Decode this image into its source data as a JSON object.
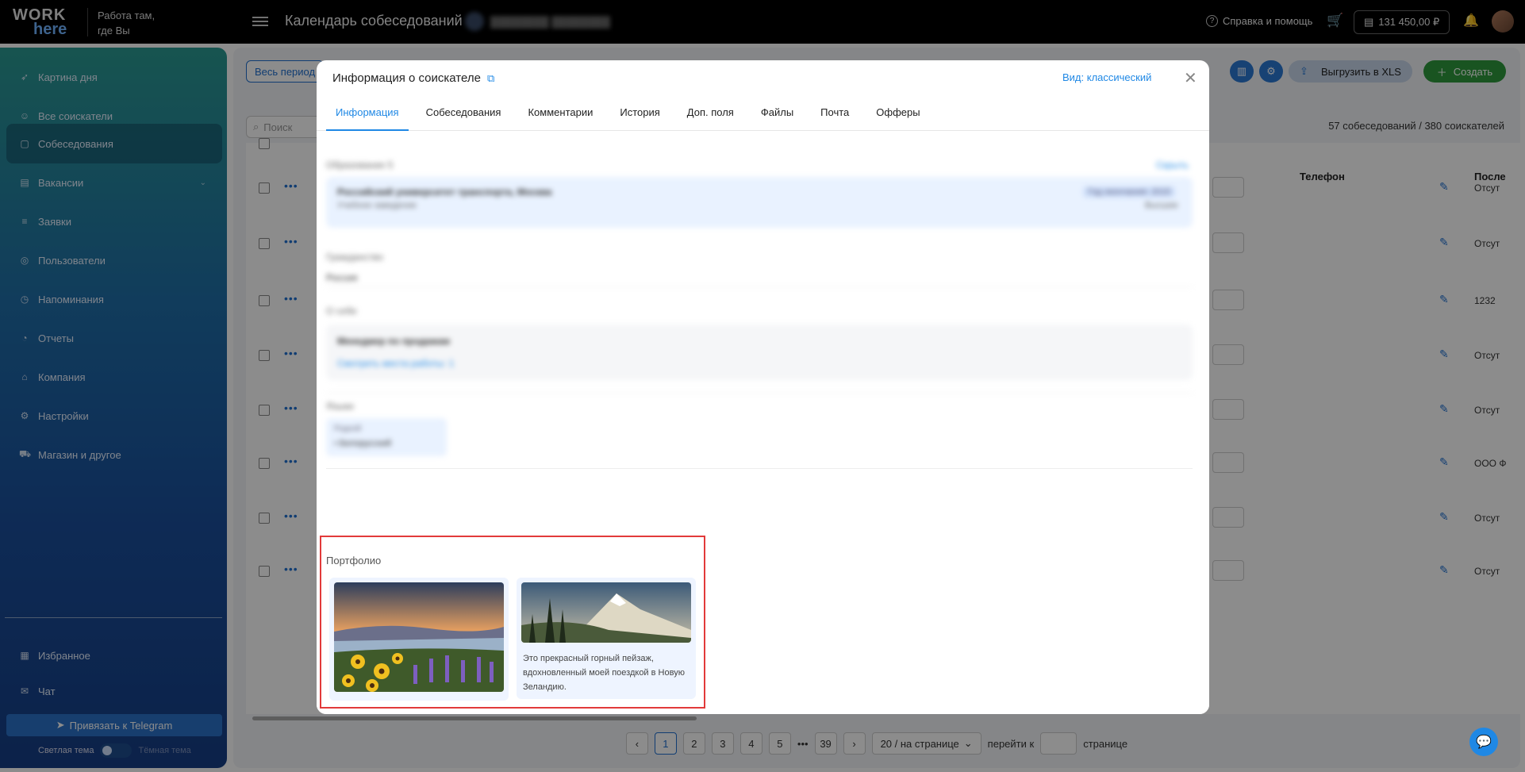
{
  "topbar": {
    "logo_line1": "WORK",
    "logo_line2": "here",
    "slogan_line1": "Работа там,",
    "slogan_line2": "где Вы",
    "page_title": "Календарь собеседований",
    "help": "Справка и помощь",
    "balance": "131 450,00 ₽"
  },
  "sidebar": {
    "items": [
      {
        "label": "Картина дня",
        "icon": "rocket-icon"
      },
      {
        "label": "Все соискатели",
        "icon": "users-icon"
      },
      {
        "label": "Собеседования",
        "icon": "calendar-icon"
      },
      {
        "label": "Вакансии",
        "icon": "briefcase-icon"
      },
      {
        "label": "Заявки",
        "icon": "list-icon"
      },
      {
        "label": "Пользователи",
        "icon": "user-circle-icon"
      },
      {
        "label": "Напоминания",
        "icon": "clock-icon"
      },
      {
        "label": "Отчеты",
        "icon": "chart-pie-icon"
      },
      {
        "label": "Компания",
        "icon": "home-icon"
      },
      {
        "label": "Настройки",
        "icon": "gear-icon"
      },
      {
        "label": "Магазин и другое",
        "icon": "cart-icon"
      },
      {
        "label": "Избранное",
        "icon": "grid-icon"
      },
      {
        "label": "Чат",
        "icon": "chat-icon"
      }
    ],
    "telegram": "Привязать к Telegram",
    "light_theme": "Светлая тема",
    "dark_theme": "Тёмная тема"
  },
  "main": {
    "period": "Весь период",
    "search_placeholder": "Поиск",
    "export": "Выгрузить в XLS",
    "create": "Создать",
    "counts": "57 собеседований / 380 соискателей",
    "col_phone": "Телефон",
    "col_last": "После",
    "rows": [
      {
        "last": "Отсут"
      },
      {
        "last": "Отсут"
      },
      {
        "last": "1232"
      },
      {
        "last": "Отсут"
      },
      {
        "last": "Отсут"
      },
      {
        "last": "ООО Ф"
      },
      {
        "last": "Отсут"
      },
      {
        "last": "Отсут"
      }
    ],
    "pager": {
      "pages": [
        "1",
        "2",
        "3",
        "4",
        "5",
        "•••",
        "39"
      ],
      "page_size": "20 / на странице",
      "goto": "перейти к",
      "page_word": "странице"
    }
  },
  "modal": {
    "title": "Информация о соискателе",
    "view": "Вид: классический",
    "tabs": [
      "Информация",
      "Собеседования",
      "Комментарии",
      "История",
      "Доп. поля",
      "Файлы",
      "Почта",
      "Офферы"
    ],
    "education_label": "Образование 5",
    "education_hide": "Скрыть",
    "education_name": "Российский университет транспорта, Москва",
    "education_type": "Учебное заведение",
    "education_year": "Год окончания: 2015",
    "education_level": "Высшее",
    "citizenship_label": "Гражданство",
    "citizenship_value": "Россия",
    "about_label": "О себе",
    "about_title": "Менеджер по продажам",
    "about_link": "Смотреть места работы: 1",
    "languages_label": "Языки",
    "language_sub": "Родной",
    "language_value": "• Белорусский",
    "portfolio_label": "Портфолио",
    "portfolio": [
      {
        "caption": ""
      },
      {
        "caption": "Это прекрасный горный пейзаж, вдохновленный моей поездкой в Новую Зеландию."
      }
    ]
  },
  "colors": {
    "accent": "#1f88e5",
    "highlight": "#e23a3a",
    "create": "#2e9a3c"
  }
}
